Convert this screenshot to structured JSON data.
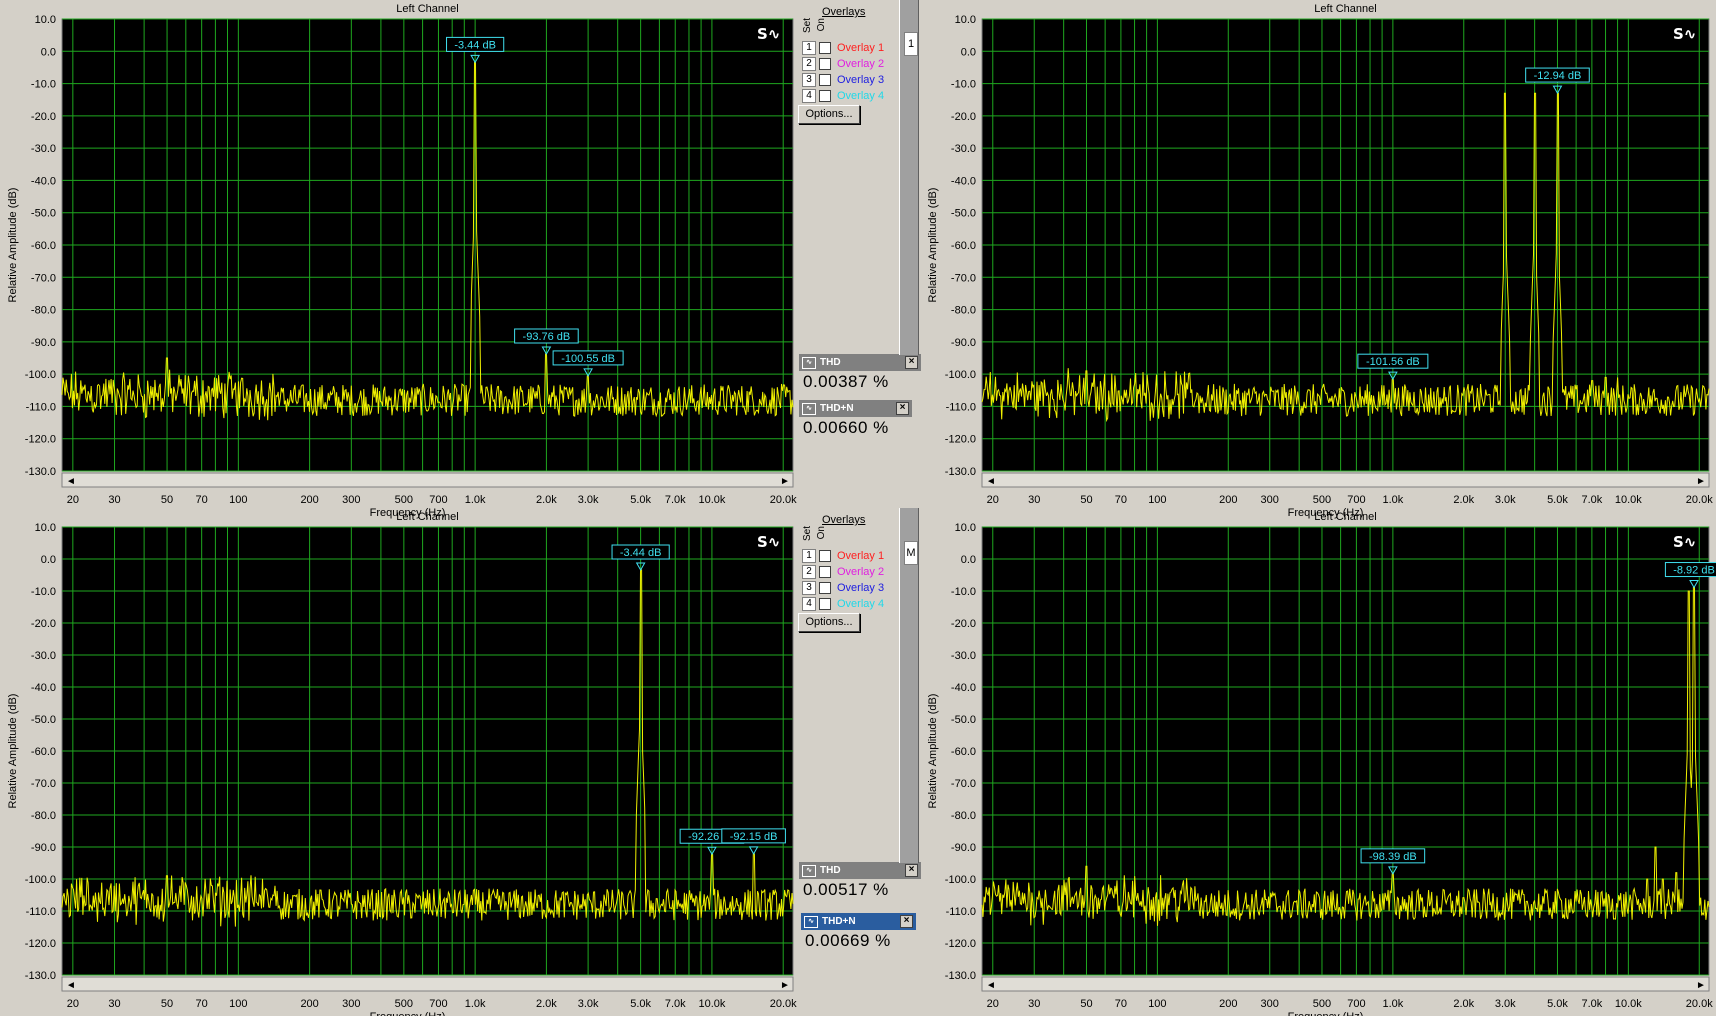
{
  "panels": [
    {
      "title": "Left Channel",
      "xlabel": "Frequency (Hz)",
      "ylabel": "Relative Amplitude (dB)",
      "markers": [
        {
          "x": 1000,
          "y": -3.44,
          "label": "-3.44 dB"
        },
        {
          "x": 2000,
          "y": -93.76,
          "label": "-93.76 dB"
        },
        {
          "x": 3000,
          "y": -100.55,
          "label": "-100.55 dB"
        }
      ]
    },
    {
      "title": "Left Channel",
      "xlabel": "Frequency (Hz)",
      "ylabel": "Relative Amplitude (dB)",
      "markers": [
        {
          "x": 1000,
          "y": -101.56,
          "label": "-101.56 dB"
        },
        {
          "x": 5000,
          "y": -12.94,
          "label": "-12.94 dB"
        }
      ]
    },
    {
      "title": "Left Channel",
      "xlabel": "Frequency (Hz)",
      "ylabel": "Relative Amplitude (dB)",
      "markers": [
        {
          "x": 5000,
          "y": -3.44,
          "label": "-3.44 dB"
        },
        {
          "x": 10000,
          "y": -92.26,
          "label": "-92.26 dB"
        },
        {
          "x": 15000,
          "y": -92.15,
          "label": "-92.15 dB"
        }
      ]
    },
    {
      "title": "Left Channel",
      "xlabel": "Frequency (Hz)",
      "ylabel": "Relative Amplitude (dB)",
      "markers": [
        {
          "x": 1000,
          "y": -98.39,
          "label": "-98.39 dB"
        },
        {
          "x": 19000,
          "y": -8.92,
          "label": "-8.92 dB"
        }
      ]
    }
  ],
  "axis": {
    "yticks": [
      "10.0",
      "0.0",
      "-10.0",
      "-20.0",
      "-30.0",
      "-40.0",
      "-50.0",
      "-60.0",
      "-70.0",
      "-80.0",
      "-90.0",
      "-100.0",
      "-110.0",
      "-120.0",
      "-130.0"
    ],
    "xticks": [
      {
        "v": 20,
        "t": "20"
      },
      {
        "v": 30,
        "t": "30"
      },
      {
        "v": 50,
        "t": "50"
      },
      {
        "v": 70,
        "t": "70"
      },
      {
        "v": 100,
        "t": "100"
      },
      {
        "v": 200,
        "t": "200"
      },
      {
        "v": 300,
        "t": "300"
      },
      {
        "v": 500,
        "t": "500"
      },
      {
        "v": 700,
        "t": "700"
      },
      {
        "v": 1000,
        "t": "1.0k"
      },
      {
        "v": 2000,
        "t": "2.0k"
      },
      {
        "v": 3000,
        "t": "3.0k"
      },
      {
        "v": 5000,
        "t": "5.0k"
      },
      {
        "v": 7000,
        "t": "7.0k"
      },
      {
        "v": 10000,
        "t": "10.0k"
      },
      {
        "v": 20000,
        "t": "20.0k"
      }
    ]
  },
  "overlays": {
    "title": "Overlays",
    "header_set": "Set",
    "header_on": "On",
    "items": [
      {
        "num": "1",
        "label": "Overlay 1",
        "color": "#ff2020"
      },
      {
        "num": "2",
        "label": "Overlay 2",
        "color": "#e020e0"
      },
      {
        "num": "3",
        "label": "Overlay 3",
        "color": "#2020e0"
      },
      {
        "num": "4",
        "label": "Overlay 4",
        "color": "#20d8e8"
      }
    ],
    "options_label": "Options..."
  },
  "meters": [
    {
      "name": "THD",
      "value": "0.00387 %"
    },
    {
      "name": "THD+N",
      "value": "0.00660 %"
    },
    {
      "name": "THD",
      "value": "0.00517 %"
    },
    {
      "name": "THD+N",
      "value": "0.00669 %"
    }
  ],
  "edge_boxes": [
    "1",
    "M"
  ],
  "chart_data": [
    {
      "type": "line",
      "title": "Left Channel",
      "xlabel": "Frequency (Hz)",
      "ylabel": "Relative Amplitude (dB)",
      "xscale": "log",
      "xlim": [
        18,
        22000
      ],
      "ylim": [
        -130,
        10
      ],
      "grid": true,
      "noise_floor": -108,
      "peaks": [
        {
          "x": 50,
          "y": -95
        },
        {
          "x": 1000,
          "y": -3.44
        },
        {
          "x": 2000,
          "y": -93.76
        },
        {
          "x": 3000,
          "y": -100.55
        }
      ]
    },
    {
      "type": "line",
      "title": "Left Channel",
      "xlabel": "Frequency (Hz)",
      "ylabel": "Relative Amplitude (dB)",
      "xscale": "log",
      "xlim": [
        18,
        22000
      ],
      "ylim": [
        -130,
        10
      ],
      "grid": true,
      "noise_floor": -108,
      "peaks": [
        {
          "x": 50,
          "y": -99
        },
        {
          "x": 1000,
          "y": -101.56
        },
        {
          "x": 3000,
          "y": -13
        },
        {
          "x": 4000,
          "y": -13
        },
        {
          "x": 5000,
          "y": -12.94
        },
        {
          "x": 7000,
          "y": -102
        },
        {
          "x": 8000,
          "y": -101
        },
        {
          "x": 9000,
          "y": -101
        }
      ]
    },
    {
      "type": "line",
      "title": "Left Channel",
      "xlabel": "Frequency (Hz)",
      "ylabel": "Relative Amplitude (dB)",
      "xscale": "log",
      "xlim": [
        18,
        22000
      ],
      "ylim": [
        -130,
        10
      ],
      "grid": true,
      "noise_floor": -108,
      "peaks": [
        {
          "x": 50,
          "y": -99
        },
        {
          "x": 5000,
          "y": -3.44
        },
        {
          "x": 10000,
          "y": -92.26
        },
        {
          "x": 15000,
          "y": -92.15
        }
      ]
    },
    {
      "type": "line",
      "title": "Left Channel",
      "xlabel": "Frequency (Hz)",
      "ylabel": "Relative Amplitude (dB)",
      "xscale": "log",
      "xlim": [
        18,
        22000
      ],
      "ylim": [
        -130,
        10
      ],
      "grid": true,
      "noise_floor": -108,
      "peaks": [
        {
          "x": 50,
          "y": -96
        },
        {
          "x": 1000,
          "y": -98.39
        },
        {
          "x": 12000,
          "y": -100
        },
        {
          "x": 13000,
          "y": -90
        },
        {
          "x": 14000,
          "y": -100
        },
        {
          "x": 16000,
          "y": -98
        },
        {
          "x": 18000,
          "y": -10
        },
        {
          "x": 19000,
          "y": -8.92
        }
      ]
    }
  ]
}
